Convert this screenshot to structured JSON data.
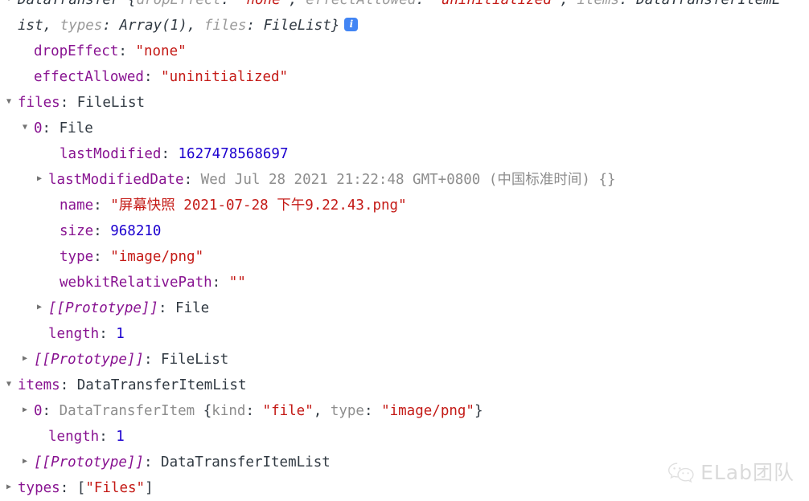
{
  "console": {
    "rows": [
      {
        "indent": 0,
        "arrow": "open",
        "segments": [
          {
            "text": "DataTransfer",
            "cls": "darkital"
          },
          {
            "text": " {",
            "cls": "darkital"
          },
          {
            "text": "dropEffect",
            "cls": "greyital"
          },
          {
            "text": ": ",
            "cls": "darkital"
          },
          {
            "text": "\"none\"",
            "cls": "str ital"
          },
          {
            "text": ", ",
            "cls": "darkital"
          },
          {
            "text": "effectAllowed",
            "cls": "greyital"
          },
          {
            "text": ": ",
            "cls": "darkital"
          },
          {
            "text": "\"uninitialized\"",
            "cls": "str ital"
          },
          {
            "text": ", ",
            "cls": "darkital"
          },
          {
            "text": "items",
            "cls": "greyital"
          },
          {
            "text": ": ",
            "cls": "darkital"
          },
          {
            "text": "DataTransferItemL",
            "cls": "darkital"
          }
        ]
      },
      {
        "indent": 0,
        "arrow": "none",
        "segments": [
          {
            "text": "ist, ",
            "cls": "darkital"
          },
          {
            "text": "types",
            "cls": "greyital"
          },
          {
            "text": ": ",
            "cls": "darkital"
          },
          {
            "text": "Array(1)",
            "cls": "darkital"
          },
          {
            "text": ", ",
            "cls": "darkital"
          },
          {
            "text": "files",
            "cls": "greyital"
          },
          {
            "text": ": ",
            "cls": "darkital"
          },
          {
            "text": "FileList}",
            "cls": "darkital"
          }
        ],
        "badge": "i"
      },
      {
        "indent": 1,
        "arrow": "none",
        "segments": [
          {
            "text": "dropEffect",
            "cls": "prop"
          },
          {
            "text": ": ",
            "cls": "colon"
          },
          {
            "text": "\"none\"",
            "cls": "str"
          }
        ]
      },
      {
        "indent": 1,
        "arrow": "none",
        "segments": [
          {
            "text": "effectAllowed",
            "cls": "prop"
          },
          {
            "text": ": ",
            "cls": "colon"
          },
          {
            "text": "\"uninitialized\"",
            "cls": "str"
          }
        ]
      },
      {
        "indent": 0,
        "arrow": "open",
        "segments": [
          {
            "text": "files",
            "cls": "prop"
          },
          {
            "text": ": ",
            "cls": "colon"
          },
          {
            "text": "FileList",
            "cls": "obj"
          }
        ]
      },
      {
        "indent": 1,
        "arrow": "open",
        "segments": [
          {
            "text": "0",
            "cls": "prop"
          },
          {
            "text": ": ",
            "cls": "colon"
          },
          {
            "text": "File",
            "cls": "obj"
          }
        ]
      },
      {
        "indent": 3,
        "arrow": "none",
        "segments": [
          {
            "text": "lastModified",
            "cls": "prop"
          },
          {
            "text": ": ",
            "cls": "colon"
          },
          {
            "text": "1627478568697",
            "cls": "num"
          }
        ]
      },
      {
        "indent": 2,
        "arrow": "closed",
        "segments": [
          {
            "text": "lastModifiedDate",
            "cls": "prop"
          },
          {
            "text": ": ",
            "cls": "colon"
          },
          {
            "text": "Wed Jul 28 2021 21:22:48 GMT+0800 (中国标准时间) {}",
            "cls": "propgrey"
          }
        ]
      },
      {
        "indent": 3,
        "arrow": "none",
        "segments": [
          {
            "text": "name",
            "cls": "prop"
          },
          {
            "text": ": ",
            "cls": "colon"
          },
          {
            "text": "\"屏幕快照 2021-07-28 下午9.22.43.png\"",
            "cls": "str"
          }
        ]
      },
      {
        "indent": 3,
        "arrow": "none",
        "segments": [
          {
            "text": "size",
            "cls": "prop"
          },
          {
            "text": ": ",
            "cls": "colon"
          },
          {
            "text": "968210",
            "cls": "num"
          }
        ]
      },
      {
        "indent": 3,
        "arrow": "none",
        "segments": [
          {
            "text": "type",
            "cls": "prop"
          },
          {
            "text": ": ",
            "cls": "colon"
          },
          {
            "text": "\"image/png\"",
            "cls": "str"
          }
        ]
      },
      {
        "indent": 3,
        "arrow": "none",
        "segments": [
          {
            "text": "webkitRelativePath",
            "cls": "prop"
          },
          {
            "text": ": ",
            "cls": "colon"
          },
          {
            "text": "\"\"",
            "cls": "str"
          }
        ]
      },
      {
        "indent": 2,
        "arrow": "closed",
        "segments": [
          {
            "text": "[[Prototype]]",
            "cls": "proto"
          },
          {
            "text": ": ",
            "cls": "colon"
          },
          {
            "text": "File",
            "cls": "obj"
          }
        ]
      },
      {
        "indent": 2,
        "arrow": "none",
        "segments": [
          {
            "text": "length",
            "cls": "prop"
          },
          {
            "text": ": ",
            "cls": "colon"
          },
          {
            "text": "1",
            "cls": "num"
          }
        ]
      },
      {
        "indent": 1,
        "arrow": "closed",
        "segments": [
          {
            "text": "[[Prototype]]",
            "cls": "proto"
          },
          {
            "text": ": ",
            "cls": "colon"
          },
          {
            "text": "FileList",
            "cls": "obj"
          }
        ]
      },
      {
        "indent": 0,
        "arrow": "open",
        "segments": [
          {
            "text": "items",
            "cls": "prop"
          },
          {
            "text": ": ",
            "cls": "colon"
          },
          {
            "text": "DataTransferItemList",
            "cls": "obj"
          }
        ]
      },
      {
        "indent": 1,
        "arrow": "closed",
        "segments": [
          {
            "text": "0",
            "cls": "prop"
          },
          {
            "text": ": ",
            "cls": "colon"
          },
          {
            "text": "DataTransferItem ",
            "cls": "propgrey"
          },
          {
            "text": "{",
            "cls": "obj"
          },
          {
            "text": "kind",
            "cls": "propgrey"
          },
          {
            "text": ": ",
            "cls": "obj"
          },
          {
            "text": "\"file\"",
            "cls": "str"
          },
          {
            "text": ", ",
            "cls": "obj"
          },
          {
            "text": "type",
            "cls": "propgrey"
          },
          {
            "text": ": ",
            "cls": "obj"
          },
          {
            "text": "\"image/png\"",
            "cls": "str"
          },
          {
            "text": "}",
            "cls": "obj"
          }
        ]
      },
      {
        "indent": 2,
        "arrow": "none",
        "segments": [
          {
            "text": "length",
            "cls": "prop"
          },
          {
            "text": ": ",
            "cls": "colon"
          },
          {
            "text": "1",
            "cls": "num"
          }
        ]
      },
      {
        "indent": 1,
        "arrow": "closed",
        "segments": [
          {
            "text": "[[Prototype]]",
            "cls": "proto"
          },
          {
            "text": ": ",
            "cls": "colon"
          },
          {
            "text": "DataTransferItemList",
            "cls": "obj"
          }
        ]
      },
      {
        "indent": 0,
        "arrow": "closed",
        "segments": [
          {
            "text": "types",
            "cls": "prop"
          },
          {
            "text": ": ",
            "cls": "colon"
          },
          {
            "text": "[",
            "cls": "obj"
          },
          {
            "text": "\"Files\"",
            "cls": "str"
          },
          {
            "text": "]",
            "cls": "obj"
          }
        ]
      }
    ]
  },
  "watermark": {
    "label": "ELab团队",
    "icon": "wechat-icon"
  },
  "colors": {
    "property": "#881391",
    "string": "#c41a16",
    "number": "#1c00cf",
    "plain": "#303942",
    "grey": "#8d8d8d",
    "badge_blue": "#4285f4",
    "background": "#ffffff"
  }
}
